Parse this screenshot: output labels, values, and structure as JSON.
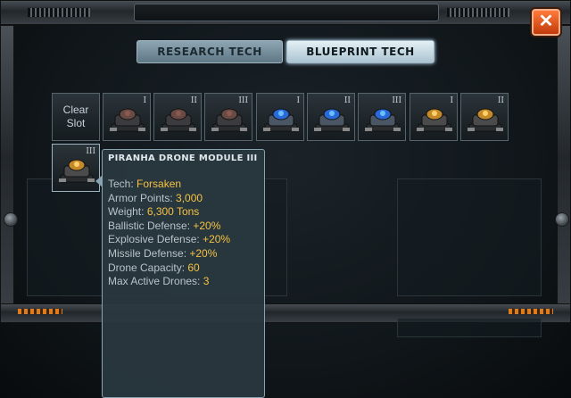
{
  "window": {
    "close_label": "✕"
  },
  "tabs": [
    {
      "label": "RESEARCH TECH",
      "selected": false
    },
    {
      "label": "BLUEPRINT TECH",
      "selected": true
    }
  ],
  "slots": {
    "clear_label_line1": "Clear",
    "clear_label_line2": "Slot",
    "items": [
      {
        "tier": "I",
        "kind": "dark-turret"
      },
      {
        "tier": "II",
        "kind": "dark-turret"
      },
      {
        "tier": "III",
        "kind": "dark-turret"
      },
      {
        "tier": "I",
        "kind": "blue-drone"
      },
      {
        "tier": "II",
        "kind": "blue-drone"
      },
      {
        "tier": "III",
        "kind": "blue-drone"
      },
      {
        "tier": "I",
        "kind": "orange-drone"
      },
      {
        "tier": "II",
        "kind": "orange-drone"
      },
      {
        "tier": "III",
        "kind": "orange-drone"
      }
    ]
  },
  "tooltip": {
    "title": "PIRANHA DRONE MODULE III",
    "rows": [
      {
        "label": "Tech: ",
        "value": "Forsaken"
      },
      {
        "label": "Armor Points: ",
        "value": "3,000"
      },
      {
        "label": "Weight: ",
        "value": "6,300 Tons"
      },
      {
        "label": "Ballistic Defense: ",
        "value": "+20%"
      },
      {
        "label": "Explosive Defense: ",
        "value": "+20%"
      },
      {
        "label": "Missile Defense: ",
        "value": "+20%"
      },
      {
        "label": "Drone Capacity: ",
        "value": "60"
      },
      {
        "label": "Max Active Drones: ",
        "value": "3"
      }
    ]
  },
  "colors": {
    "accent": "#f5c243",
    "close": "#d84a14",
    "tab_active": "#cfe4ee"
  }
}
